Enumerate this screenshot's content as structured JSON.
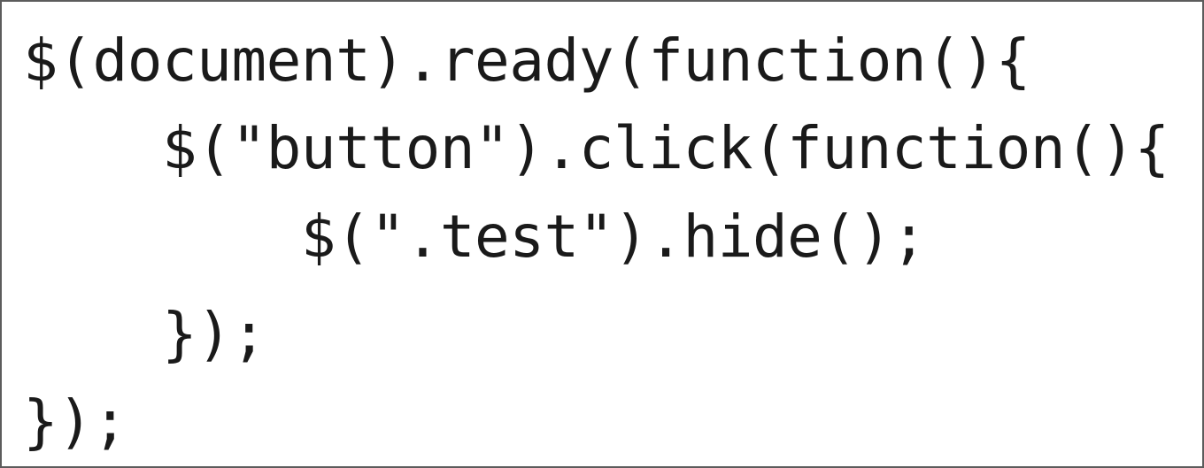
{
  "code": {
    "lines": [
      "$(document).ready(function(){",
      "    $(\"button\").click(function(){",
      "        $(\".test\").hide();",
      "    });",
      "});"
    ]
  }
}
